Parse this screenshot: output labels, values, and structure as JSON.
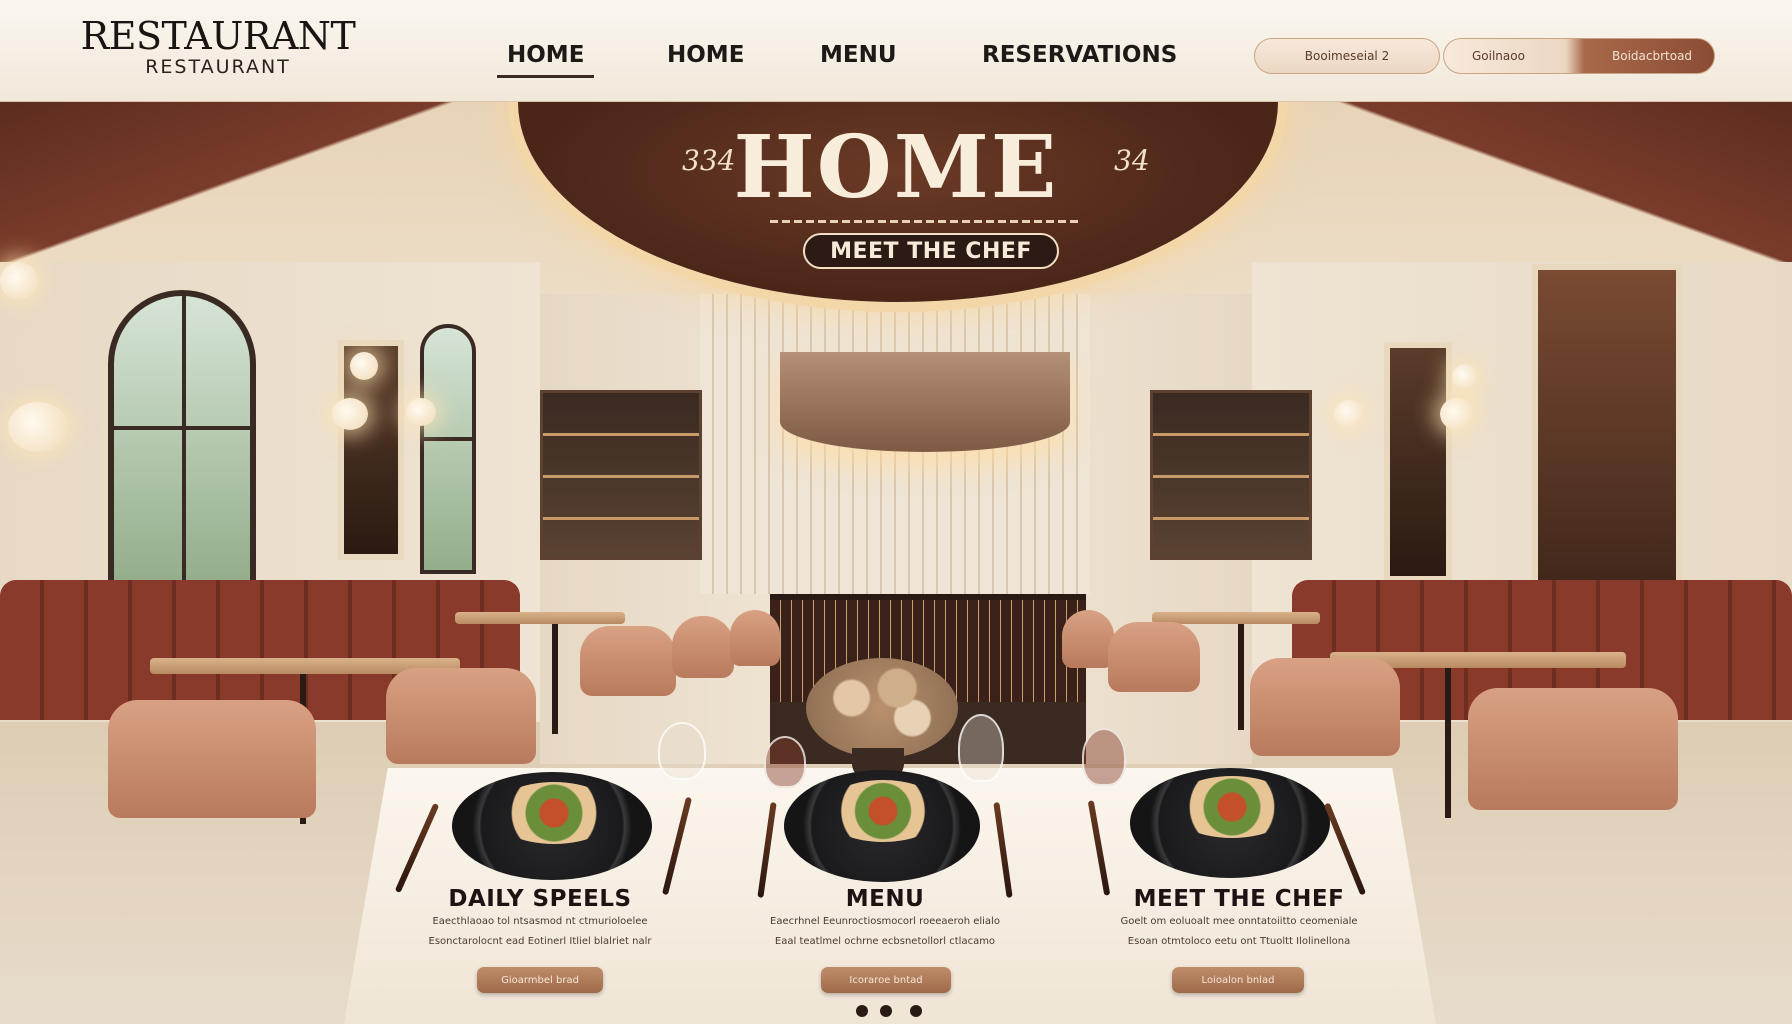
{
  "header": {
    "logo_main": "RESTAURANT",
    "logo_sub": "RESTAURANT",
    "nav": [
      {
        "label": "HOME"
      },
      {
        "label": "HOME"
      },
      {
        "label": "MENU"
      },
      {
        "label": "RESERVATIONS"
      }
    ],
    "buttons": [
      "Booimeseial 2",
      "Goilnaoo",
      "Boidacbrtoad"
    ]
  },
  "hero": {
    "title": "HOME",
    "num_left": "334",
    "num_right": "34",
    "pill": "MEET THE CHEF"
  },
  "cards": [
    {
      "title": "DAILY SPEELS",
      "desc_1": "Eaecthlaoao tol ntsasmod nt ctmurioloelee",
      "desc_2": "Esonctarolocnt ead Eotinerl Itliel  blalriet nalr",
      "button": "Gioarmbel brad"
    },
    {
      "title": "MENU",
      "desc_1": "Eaecrhnel Eeunroctiosmocorl roeeaeroh elialo",
      "desc_2": "Eaal teatlmel ochrne ecbsnetollorl ctlacamo",
      "button": "Icoraroe bntad"
    },
    {
      "title": "MEET THE CHEF",
      "desc_1": "Goelt om eoluoalt mee onntatoiitto ceomeniale",
      "desc_2": "Esoan otmtoloco eetu ont Ttuoltt Ilolinellona",
      "button": "Loioalon bnlad"
    }
  ],
  "carousel": {
    "count": 3,
    "active": 0
  },
  "colors": {
    "accent": "#8a4c34",
    "dark": "#2c1a14",
    "cream": "#f4ece0",
    "button": "#a8714f"
  }
}
